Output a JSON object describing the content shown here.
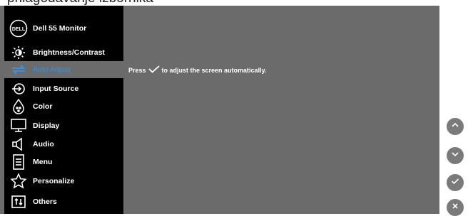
{
  "caption": "prilagođavanje izbornika",
  "menu": {
    "title": "Dell 55 Monitor",
    "logo_text": "DELL",
    "items": [
      {
        "label": "Brightness/Contrast",
        "icon": "brightness-icon"
      },
      {
        "label": "Auto Adjust",
        "icon": "auto-adjust-icon",
        "active": true
      },
      {
        "label": "Input Source",
        "icon": "input-source-icon"
      },
      {
        "label": "Color",
        "icon": "color-icon"
      },
      {
        "label": "Display",
        "icon": "display-icon"
      },
      {
        "label": "Audio",
        "icon": "audio-icon"
      },
      {
        "label": "Menu",
        "icon": "menu-icon"
      },
      {
        "label": "Personalize",
        "icon": "personalize-icon"
      },
      {
        "label": "Others",
        "icon": "others-icon"
      }
    ]
  },
  "content": {
    "message_before": "Press",
    "message_after": "to adjust the screen automatically."
  },
  "nav_buttons": [
    "up-icon",
    "down-icon",
    "check-icon",
    "close-icon"
  ],
  "colors": {
    "active": "#3d8fe0",
    "sidebar": "#000000",
    "panel": "#6b6b6b"
  }
}
